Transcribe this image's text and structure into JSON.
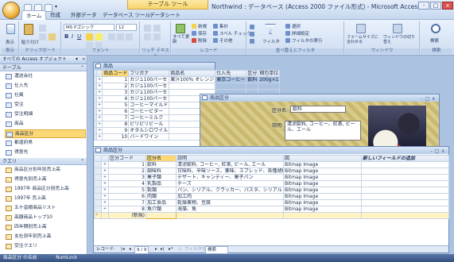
{
  "window": {
    "context_tab": "テーブル ツール",
    "title": "Northwind : データベース (Access 2000 ファイル形式) - Microsoft Access",
    "controls": [
      "‐",
      "□",
      "x"
    ]
  },
  "ribbon": {
    "tabs": [
      "ホーム",
      "作成",
      "外部データ",
      "データベース ツール",
      "データシート"
    ],
    "active_tab": "ホーム",
    "groups": [
      "表示",
      "クリップボード",
      "フォント",
      "リッチ テキスト",
      "レコード",
      "並べ替えとフィルタ",
      "ウィンドウ",
      "検索"
    ],
    "view_label": "表示",
    "paste_label": "貼り付け",
    "font_name": "MS Pゴシック",
    "font_size": "12",
    "records_buttons": [
      "新規",
      "保存",
      "削除",
      "集計",
      "スペル チェック",
      "その他"
    ],
    "refresh_label": "すべて更新",
    "filter_label": "フィルタ",
    "sort_buttons": [
      "選択",
      "詳細設定",
      "フィルタの実行"
    ],
    "window_buttons": [
      "フォームサイズに合わせる",
      "ウィンドウの切り替え"
    ],
    "find_label": "検索"
  },
  "nav": {
    "header": "すべての Access オブジェクト",
    "sections": [
      {
        "title": "テーブル",
        "items": [
          "運送会社",
          "仕入先",
          "社員",
          "受注",
          "受注明細",
          "商品",
          "商品区分",
          "都道府県",
          "得意先"
        ]
      },
      {
        "title": "クエリ",
        "items": [
          "商品区分別年別売上高",
          "得意先別売上高",
          "1997年 商品区分別売上高",
          "1997年 売上高",
          "五十音順商品リスト",
          "高額商品トップ10",
          "四半期別売上高",
          "支社別年別売上高",
          "受注クエリ"
        ]
      }
    ],
    "selected": "商品区分"
  },
  "products_window": {
    "title": "商品",
    "columns": [
      "商品コード",
      "フリガナ",
      "商品名",
      "仕入先",
      "区分",
      "梱包単位"
    ],
    "rows": [
      [
        "1",
        "カジュ100パーセ",
        "果汁100% オレンジ",
        "東京コーヒー",
        "飲料",
        "200g×1"
      ],
      [
        "2",
        "カジュ100パーセ",
        "",
        "",
        "",
        ""
      ],
      [
        "3",
        "カジュ100パーセ",
        "",
        "",
        "",
        ""
      ],
      [
        "4",
        "カジュ100パーセ",
        "",
        "",
        "",
        ""
      ],
      [
        "5",
        "コーヒーマイルド",
        "",
        "",
        "",
        ""
      ],
      [
        "6",
        "コーヒービター",
        "",
        "",
        "",
        ""
      ],
      [
        "7",
        "コーヒーミルク",
        "",
        "",
        "",
        ""
      ],
      [
        "8",
        "ピリピリビール",
        "",
        "",
        "",
        ""
      ],
      [
        "9",
        "オタルシロワイル",
        "",
        "",
        "",
        ""
      ],
      [
        "10",
        "バードワイン",
        "",
        "",
        "",
        ""
      ]
    ]
  },
  "category_form": {
    "title": "商品区分",
    "field1_label": "区分名:",
    "field1_value": "飲料",
    "field2_label": "説明:",
    "field2_value": "清涼飲料, コーヒー、紅茶, ビール、エール"
  },
  "category_table": {
    "title": "商品区分",
    "columns": [
      "区分コード",
      "区分名",
      "説明",
      "図",
      "新しいフィールドの追加"
    ],
    "rows": [
      [
        "1",
        "飲料",
        "清涼飲料, コーヒー, 紅茶, ビール, エール",
        "Bitmap Image"
      ],
      [
        "2",
        "調味料",
        "甘味料、辛味ソース、薬味、スプレッド、各種胡椒",
        "Bitmap Image"
      ],
      [
        "3",
        "菓子類",
        "デザート、キャンディー、菓子パン",
        "Bitmap Image"
      ],
      [
        "4",
        "乳製品",
        "チーズ",
        "Bitmap Image"
      ],
      [
        "5",
        "穀類",
        "パン、シリアル、クラッカー、パスタ、シリアル",
        "Bitmap Image"
      ],
      [
        "6",
        "肉類",
        "加工肉",
        "Bitmap Image"
      ],
      [
        "7",
        "加工食品",
        "乾燥果物、豆腐",
        "Bitmap Image"
      ],
      [
        "8",
        "魚介類",
        "海藻、魚",
        "Bitmap Image"
      ]
    ],
    "new_row_label": "(新規)",
    "record_nav": {
      "prefix": "レコード:",
      "position": "9 / 9",
      "filter": "フィルタなし",
      "search": "検索"
    }
  },
  "status": {
    "left": "商品区分 の名前",
    "mid": "NumLock"
  }
}
